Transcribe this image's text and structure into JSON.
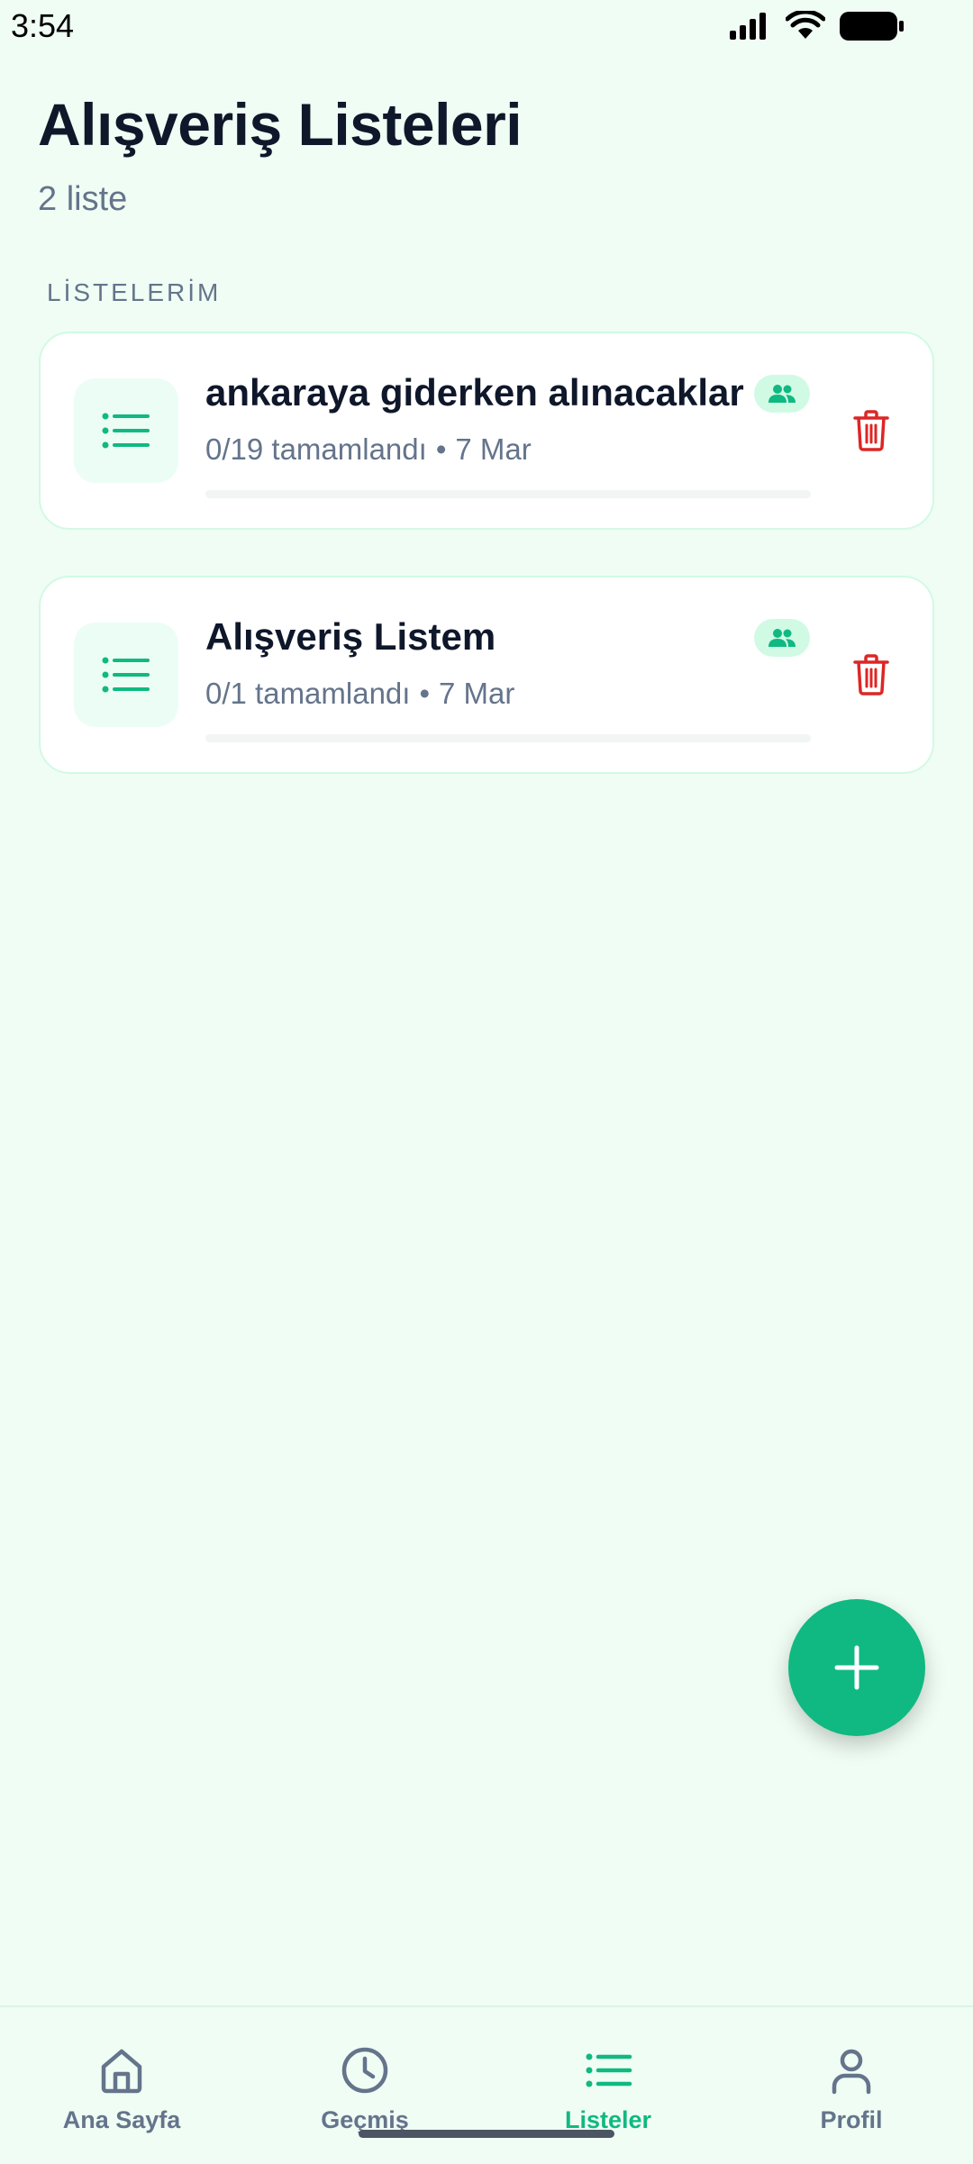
{
  "status_bar": {
    "time": "3:54"
  },
  "header": {
    "title": "Alışveriş Listeleri",
    "subtitle": "2 liste"
  },
  "section": {
    "label": "LİSTELERİM"
  },
  "lists": [
    {
      "title": "ankaraya giderken alınacaklar",
      "progress": "0/19 tamamlandı",
      "date": "7 Mar",
      "progress_fraction": 0,
      "shared": true
    },
    {
      "title": "Alışveriş Listem",
      "progress": "0/1 tamamlandı",
      "date": "7 Mar",
      "progress_fraction": 0,
      "shared": true
    }
  ],
  "fab": {
    "icon": "plus-icon"
  },
  "bottom_nav": {
    "active": "Listeler",
    "items": [
      {
        "label": "Ana Sayfa",
        "icon": "home-icon"
      },
      {
        "label": "Geçmiş",
        "icon": "clock-icon"
      },
      {
        "label": "Listeler",
        "icon": "list-icon"
      },
      {
        "label": "Profil",
        "icon": "user-icon"
      }
    ]
  },
  "colors": {
    "background": "#f0fdf4",
    "accent": "#10b981",
    "danger": "#dc2626",
    "text_primary": "#0f172a",
    "text_secondary": "#64748b"
  }
}
